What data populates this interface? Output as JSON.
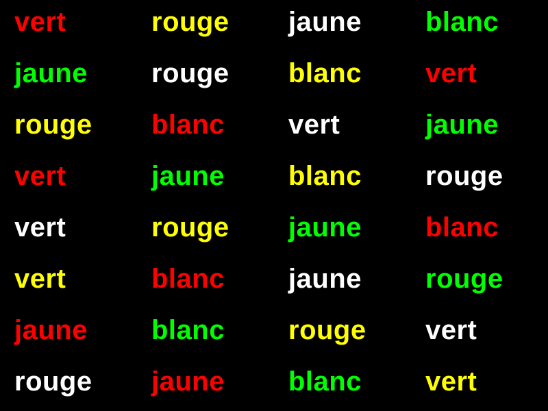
{
  "colors": {
    "background": "#000000",
    "red": "#FF0000",
    "yellow": "#FFFF00",
    "white": "#FFFFFF",
    "green": "#00FF00"
  },
  "rows": [
    [
      {
        "text": "vert",
        "color": "red"
      },
      {
        "text": "rouge",
        "color": "yellow"
      },
      {
        "text": "jaune",
        "color": "white"
      },
      {
        "text": "blanc",
        "color": "green"
      }
    ],
    [
      {
        "text": "jaune",
        "color": "green"
      },
      {
        "text": "rouge",
        "color": "white"
      },
      {
        "text": "blanc",
        "color": "yellow"
      },
      {
        "text": "vert",
        "color": "red"
      }
    ],
    [
      {
        "text": "rouge",
        "color": "yellow"
      },
      {
        "text": "blanc",
        "color": "red"
      },
      {
        "text": "vert",
        "color": "white"
      },
      {
        "text": "jaune",
        "color": "green"
      }
    ],
    [
      {
        "text": "vert",
        "color": "red"
      },
      {
        "text": "jaune",
        "color": "green"
      },
      {
        "text": "blanc",
        "color": "yellow"
      },
      {
        "text": "rouge",
        "color": "white"
      }
    ],
    [
      {
        "text": "vert",
        "color": "white"
      },
      {
        "text": "rouge",
        "color": "yellow"
      },
      {
        "text": "jaune",
        "color": "green"
      },
      {
        "text": "blanc",
        "color": "red"
      }
    ],
    [
      {
        "text": "vert",
        "color": "yellow"
      },
      {
        "text": "blanc",
        "color": "red"
      },
      {
        "text": "jaune",
        "color": "white"
      },
      {
        "text": "rouge",
        "color": "green"
      }
    ],
    [
      {
        "text": "jaune",
        "color": "red"
      },
      {
        "text": "blanc",
        "color": "green"
      },
      {
        "text": "rouge",
        "color": "yellow"
      },
      {
        "text": "vert",
        "color": "white"
      }
    ],
    [
      {
        "text": "rouge",
        "color": "white"
      },
      {
        "text": "jaune",
        "color": "red"
      },
      {
        "text": "blanc",
        "color": "green"
      },
      {
        "text": "vert",
        "color": "yellow"
      }
    ]
  ]
}
